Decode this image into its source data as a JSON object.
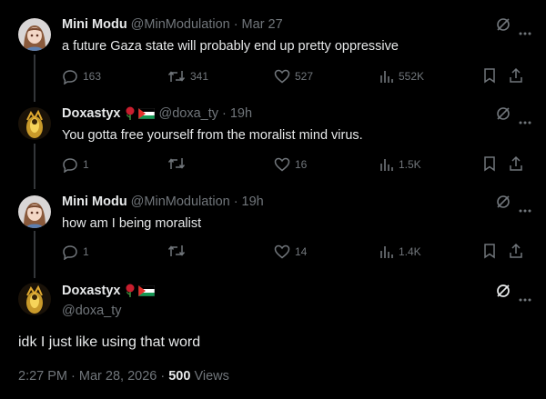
{
  "tweets": [
    {
      "name": "Mini Modu",
      "handle": "@MinModulation",
      "time": "Mar 27",
      "text": "a future Gaza state will probably end up pretty oppressive",
      "replies": "163",
      "retweets": "341",
      "likes": "527",
      "views": "552K"
    },
    {
      "name": "Doxastyx",
      "handle": "@doxa_ty",
      "time": "19h",
      "text": "You gotta free yourself from the moralist mind virus.",
      "replies": "1",
      "retweets": "",
      "likes": "16",
      "views": "1.5K"
    },
    {
      "name": "Mini Modu",
      "handle": "@MinModulation",
      "time": "19h",
      "text": "how am I being moralist",
      "replies": "1",
      "retweets": "",
      "likes": "14",
      "views": "1.4K"
    }
  ],
  "main": {
    "name": "Doxastyx",
    "handle": "@doxa_ty",
    "text": "idk I just like using that word",
    "timestamp": "2:27 PM · Mar 28, 2026",
    "views_count": "500",
    "views_label": "Views"
  },
  "separator": "·",
  "colors": {
    "background": "#000000",
    "text": "#e7e9ea",
    "muted": "#71767b",
    "line": "#333639"
  }
}
